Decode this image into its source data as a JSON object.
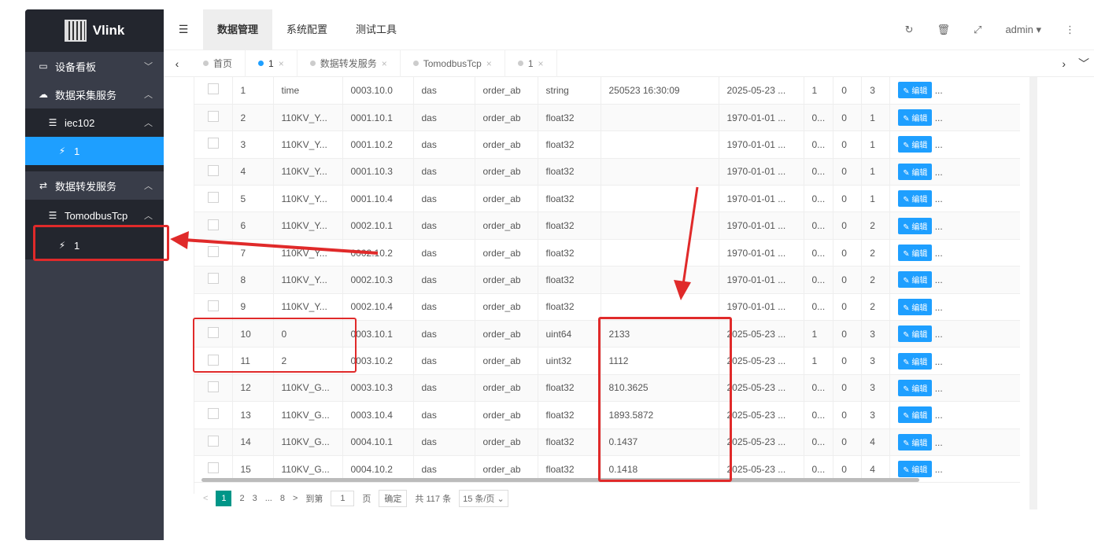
{
  "app": {
    "name": "Vlink"
  },
  "sidebar": {
    "items": [
      {
        "label": "设备看板",
        "icon": "monitor-icon",
        "arrow": "﹀"
      },
      {
        "label": "数据采集服务",
        "icon": "cloud-icon",
        "arrow": "︿"
      },
      {
        "label": "iec102",
        "icon": "server-icon",
        "arrow": "︿"
      },
      {
        "label": "1",
        "icon": "plug-icon"
      },
      {
        "label": "数据转发服务",
        "icon": "shuffle-icon",
        "arrow": "︿"
      },
      {
        "label": "TomodbusTcp",
        "icon": "server-icon",
        "arrow": "︿"
      },
      {
        "label": "1",
        "icon": "plug-icon"
      }
    ]
  },
  "topbar": {
    "tabs": [
      "数据管理",
      "系统配置",
      "测试工具"
    ],
    "user": "admin"
  },
  "open_tabs": [
    {
      "label": "首页"
    },
    {
      "label": "1",
      "close": "×"
    },
    {
      "label": "数据转发服务",
      "close": "×"
    },
    {
      "label": "TomodbusTcp",
      "close": "×"
    },
    {
      "label": "1",
      "close": "×"
    }
  ],
  "table": {
    "edit_label": "编辑",
    "rows": [
      [
        "1",
        "time",
        "0003.10.0",
        "das",
        "order_ab",
        "string",
        "250523 16:30:09",
        "2025-05-23 ...",
        "1",
        "0",
        "3"
      ],
      [
        "2",
        "110KV_Y...",
        "0001.10.1",
        "das",
        "order_ab",
        "float32",
        "",
        "1970-01-01 ...",
        "0...",
        "0",
        "1"
      ],
      [
        "3",
        "110KV_Y...",
        "0001.10.2",
        "das",
        "order_ab",
        "float32",
        "",
        "1970-01-01 ...",
        "0...",
        "0",
        "1"
      ],
      [
        "4",
        "110KV_Y...",
        "0001.10.3",
        "das",
        "order_ab",
        "float32",
        "",
        "1970-01-01 ...",
        "0...",
        "0",
        "1"
      ],
      [
        "5",
        "110KV_Y...",
        "0001.10.4",
        "das",
        "order_ab",
        "float32",
        "",
        "1970-01-01 ...",
        "0...",
        "0",
        "1"
      ],
      [
        "6",
        "110KV_Y...",
        "0002.10.1",
        "das",
        "order_ab",
        "float32",
        "",
        "1970-01-01 ...",
        "0...",
        "0",
        "2"
      ],
      [
        "7",
        "110KV_Y...",
        "0002.10.2",
        "das",
        "order_ab",
        "float32",
        "",
        "1970-01-01 ...",
        "0...",
        "0",
        "2"
      ],
      [
        "8",
        "110KV_Y...",
        "0002.10.3",
        "das",
        "order_ab",
        "float32",
        "",
        "1970-01-01 ...",
        "0...",
        "0",
        "2"
      ],
      [
        "9",
        "110KV_Y...",
        "0002.10.4",
        "das",
        "order_ab",
        "float32",
        "",
        "1970-01-01 ...",
        "0...",
        "0",
        "2"
      ],
      [
        "10",
        "0",
        "0003.10.1",
        "das",
        "order_ab",
        "uint64",
        "2133",
        "2025-05-23 ...",
        "1",
        "0",
        "3"
      ],
      [
        "11",
        "2",
        "0003.10.2",
        "das",
        "order_ab",
        "uint32",
        "1112",
        "2025-05-23 ...",
        "1",
        "0",
        "3"
      ],
      [
        "12",
        "110KV_G...",
        "0003.10.3",
        "das",
        "order_ab",
        "float32",
        "810.3625",
        "2025-05-23 ...",
        "0...",
        "0",
        "3"
      ],
      [
        "13",
        "110KV_G...",
        "0003.10.4",
        "das",
        "order_ab",
        "float32",
        "1893.5872",
        "2025-05-23 ...",
        "0...",
        "0",
        "3"
      ],
      [
        "14",
        "110KV_G...",
        "0004.10.1",
        "das",
        "order_ab",
        "float32",
        "0.1437",
        "2025-05-23 ...",
        "0...",
        "0",
        "4"
      ],
      [
        "15",
        "110KV_G...",
        "0004.10.2",
        "das",
        "order_ab",
        "float32",
        "0.1418",
        "2025-05-23 ...",
        "0...",
        "0",
        "4"
      ]
    ]
  },
  "pager": {
    "prev": "<",
    "pages": [
      "1",
      "2",
      "3",
      "...",
      "8"
    ],
    "next": ">",
    "goto_label": "到第",
    "goto_value": "1",
    "page_unit": "页",
    "confirm": "确定",
    "total": "共 117 条",
    "per_page": "15 条/页"
  },
  "annotation": {
    "color": "#e02a2a"
  }
}
